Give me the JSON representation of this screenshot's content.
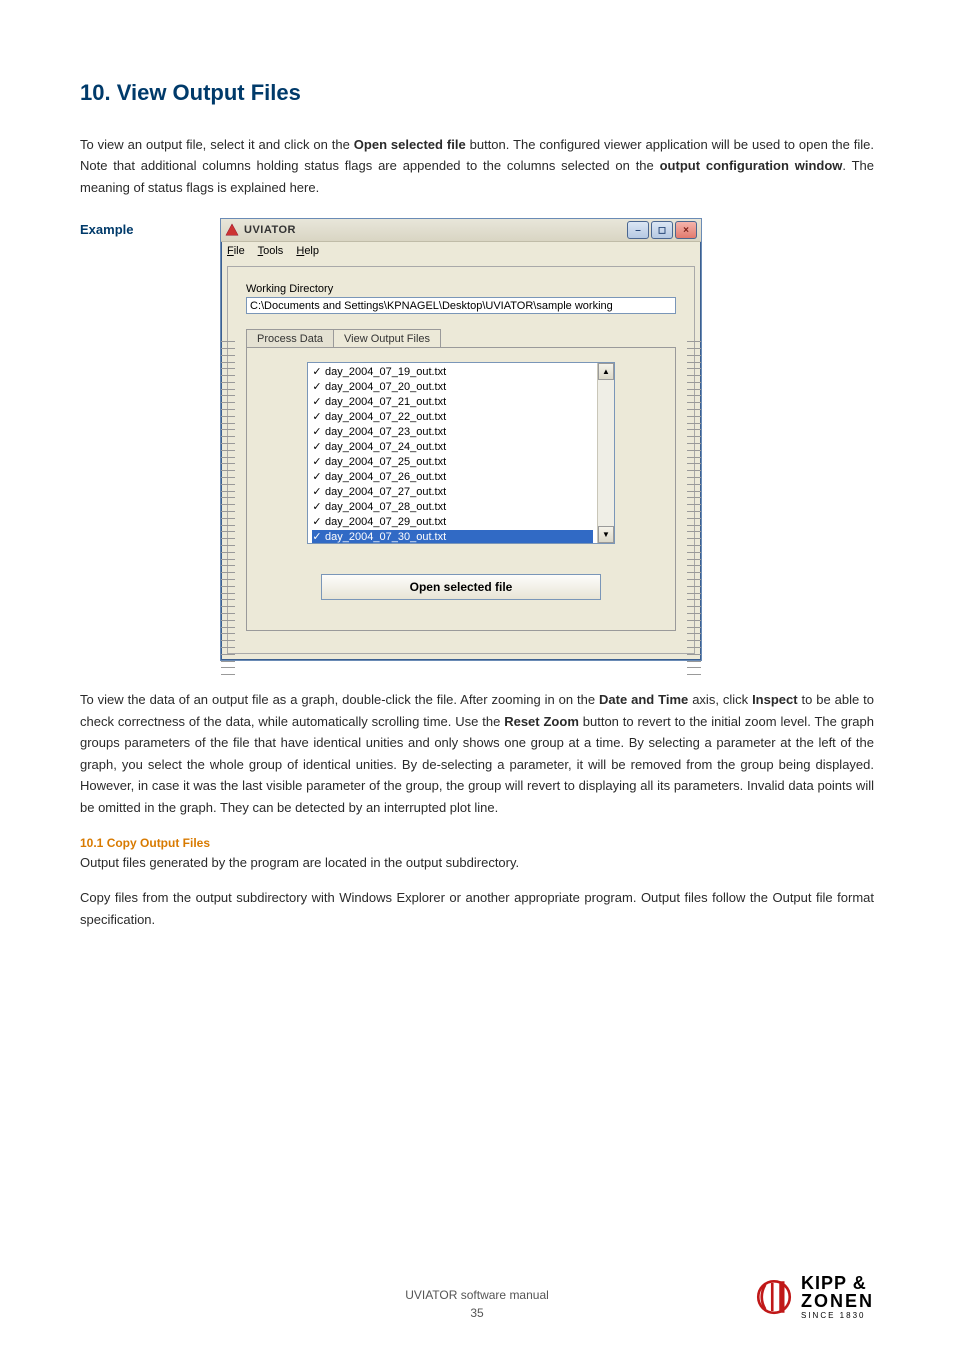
{
  "heading": "10. View Output Files",
  "para1_a": "To view an output file, select it and click on the ",
  "para1_b": "Open selected file",
  "para1_c": " button. The configured viewer application will be used to open the file. Note that additional columns holding status flags are appended to the columns selected on the ",
  "para1_d": "output configuration window",
  "para1_e": ". The meaning of status flags is explained here.",
  "example_label": "Example",
  "app": {
    "title": "UVIATOR",
    "menu": {
      "file": "File",
      "tools": "Tools",
      "help": "Help"
    },
    "working_dir_label": "Working Directory",
    "working_dir_value": "C:\\Documents and Settings\\KPNAGEL\\Desktop\\UVIATOR\\sample working",
    "tab_process": "Process Data",
    "tab_view": "View Output Files",
    "files": [
      "day_2004_07_19_out.txt",
      "day_2004_07_20_out.txt",
      "day_2004_07_21_out.txt",
      "day_2004_07_22_out.txt",
      "day_2004_07_23_out.txt",
      "day_2004_07_24_out.txt",
      "day_2004_07_25_out.txt",
      "day_2004_07_26_out.txt",
      "day_2004_07_27_out.txt",
      "day_2004_07_28_out.txt",
      "day_2004_07_29_out.txt",
      "day_2004_07_30_out.txt"
    ],
    "selected_index": 11,
    "open_button": "Open selected file"
  },
  "para2_a": "To view the data of an output file as a graph, double-click the file. After zooming in on the ",
  "para2_b": "Date and Time",
  "para2_c": " axis, click ",
  "para2_d": "Inspect",
  "para2_e": " to be able to check correctness of the data, while automatically scrolling time. Use the ",
  "para2_f": "Reset Zoom",
  "para2_g": " button to revert to the initial zoom level. The graph groups parameters of the file that have identical unities and only shows one group at a time. By selecting a parameter at the left of the graph, you select the whole group of identical unities. By de-selecting a parameter, it will be removed from the group being displayed. However, in case it was the last visible parameter of the group, the group will revert to displaying all its parameters. Invalid data points will be omitted in the graph. They can be detected by an interrupted plot line.",
  "sub_heading": "10.1 Copy Output Files",
  "sub_p1": "Output files generated by the program are located in the output subdirectory.",
  "sub_p2": "Copy files from the output subdirectory with Windows Explorer or another appropriate program. Output files follow the Output file format specification.",
  "footer_text": "UVIATOR software manual",
  "page_number": "35",
  "logo": {
    "line1": "KIPP &",
    "line2": "ZONEN",
    "line3": "SINCE 1830"
  }
}
